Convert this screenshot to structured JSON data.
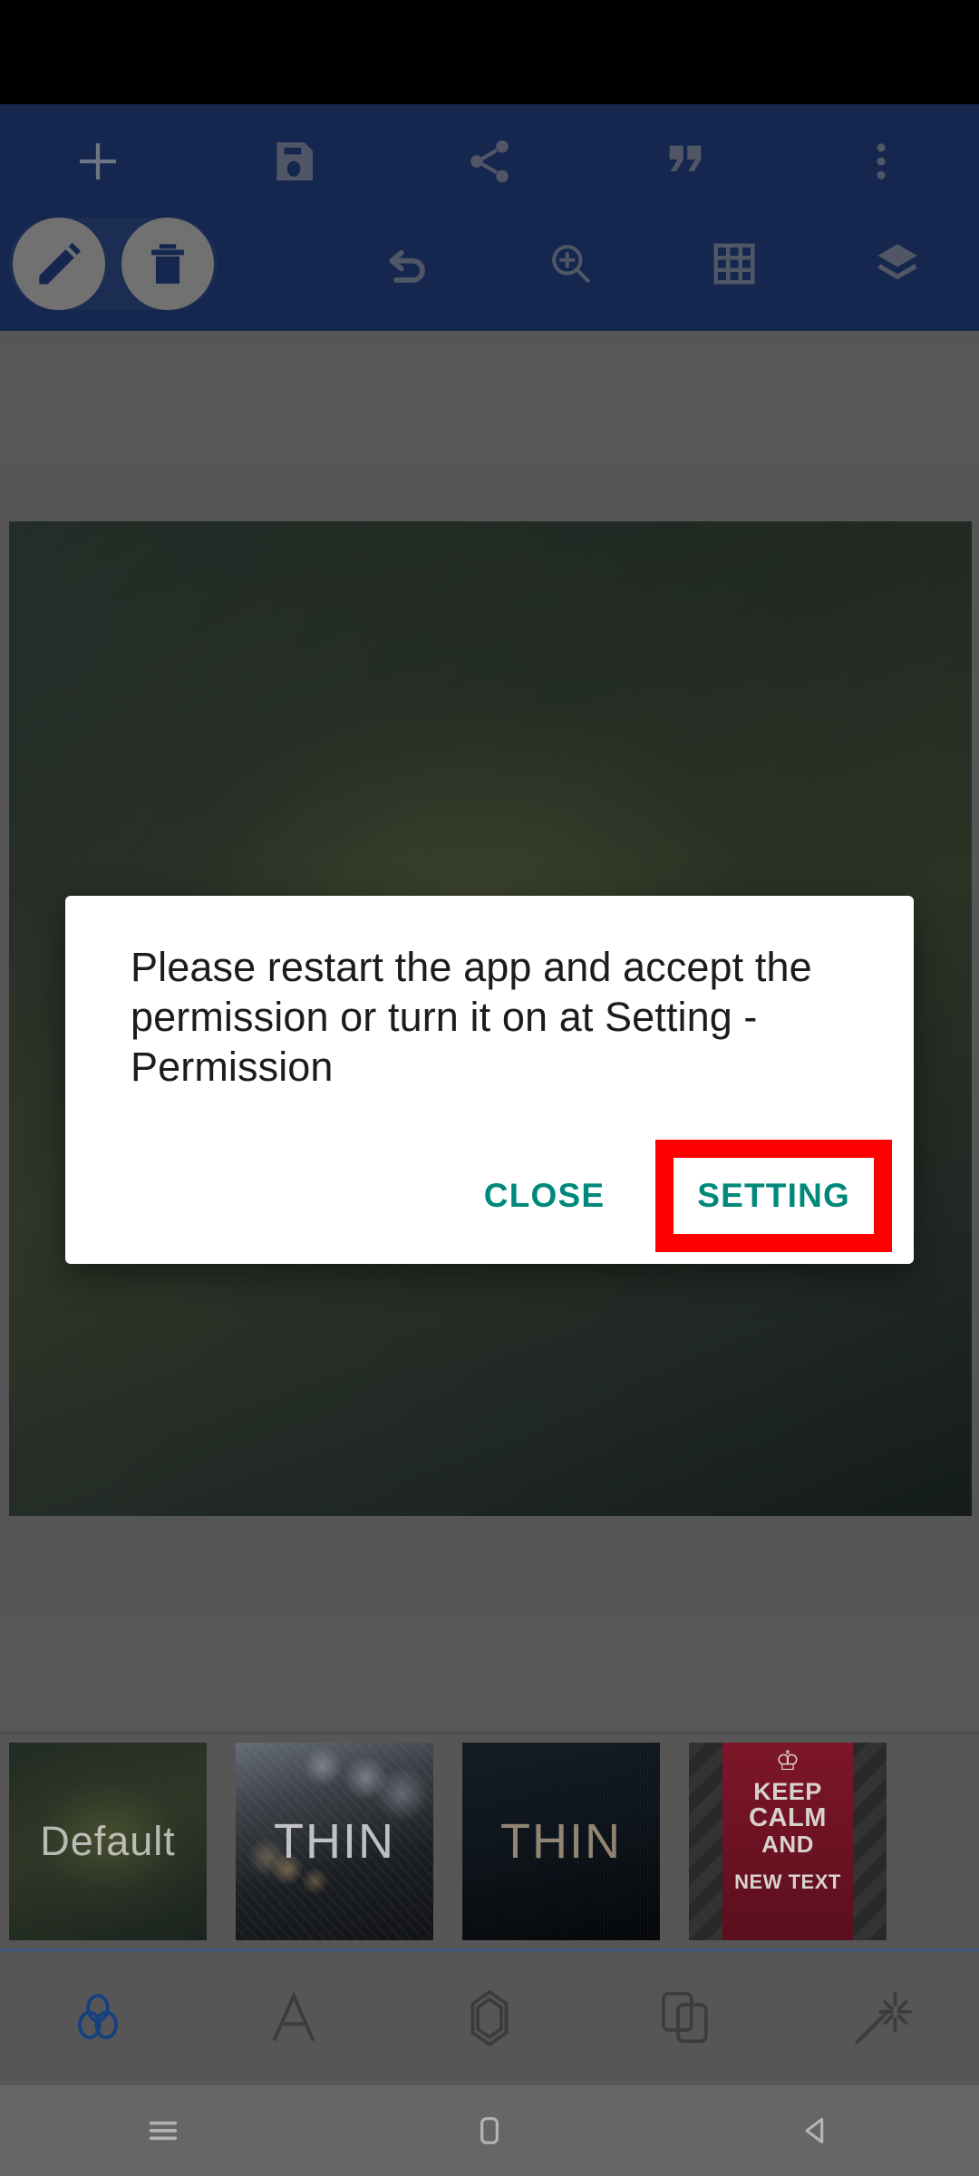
{
  "app": {
    "accent_toolbar": "#1a3060",
    "accent_dialog_action": "#00897b",
    "highlight_box": "#ff0000",
    "surface_gray": "#6a6a6a",
    "tab_active": "#1a4f9c"
  },
  "toolbar": {
    "row1": [
      {
        "name": "add-icon",
        "label": "Add"
      },
      {
        "name": "save-icon",
        "label": "Save"
      },
      {
        "name": "share-icon",
        "label": "Share"
      },
      {
        "name": "quote-icon",
        "label": "Quote"
      },
      {
        "name": "more-options-icon",
        "label": "More options"
      }
    ],
    "row2": [
      {
        "name": "edit-icon",
        "label": "Edit"
      },
      {
        "name": "delete-icon",
        "label": "Delete"
      },
      {
        "name": "undo-icon",
        "label": "Undo"
      },
      {
        "name": "zoom-in-icon",
        "label": "Zoom in"
      },
      {
        "name": "grid-icon",
        "label": "Grid"
      },
      {
        "name": "layers-icon",
        "label": "Layers"
      }
    ]
  },
  "dialog": {
    "message": "Please restart the app and accept the permission or turn it on at Setting - Permission",
    "close_label": "CLOSE",
    "setting_label": "SETTING"
  },
  "thumbnails": [
    {
      "label": "Default"
    },
    {
      "label": "THIN"
    },
    {
      "label": "THIN"
    },
    {
      "label": "",
      "poster": {
        "crown": "♔",
        "line1": "KEEP",
        "line2": "CALM",
        "line3": "AND",
        "line4": "NEW TEXT"
      }
    }
  ],
  "tabs": [
    {
      "name": "tab-filters",
      "label": "Filters",
      "active": true
    },
    {
      "name": "tab-text",
      "label": "Text",
      "active": false
    },
    {
      "name": "tab-shapes",
      "label": "Shapes",
      "active": false
    },
    {
      "name": "tab-overlays",
      "label": "Overlays",
      "active": false
    },
    {
      "name": "tab-effects",
      "label": "Effects",
      "active": false
    }
  ],
  "navbar": [
    {
      "name": "recents-button",
      "label": "Recents"
    },
    {
      "name": "home-button",
      "label": "Home"
    },
    {
      "name": "back-button",
      "label": "Back"
    }
  ]
}
